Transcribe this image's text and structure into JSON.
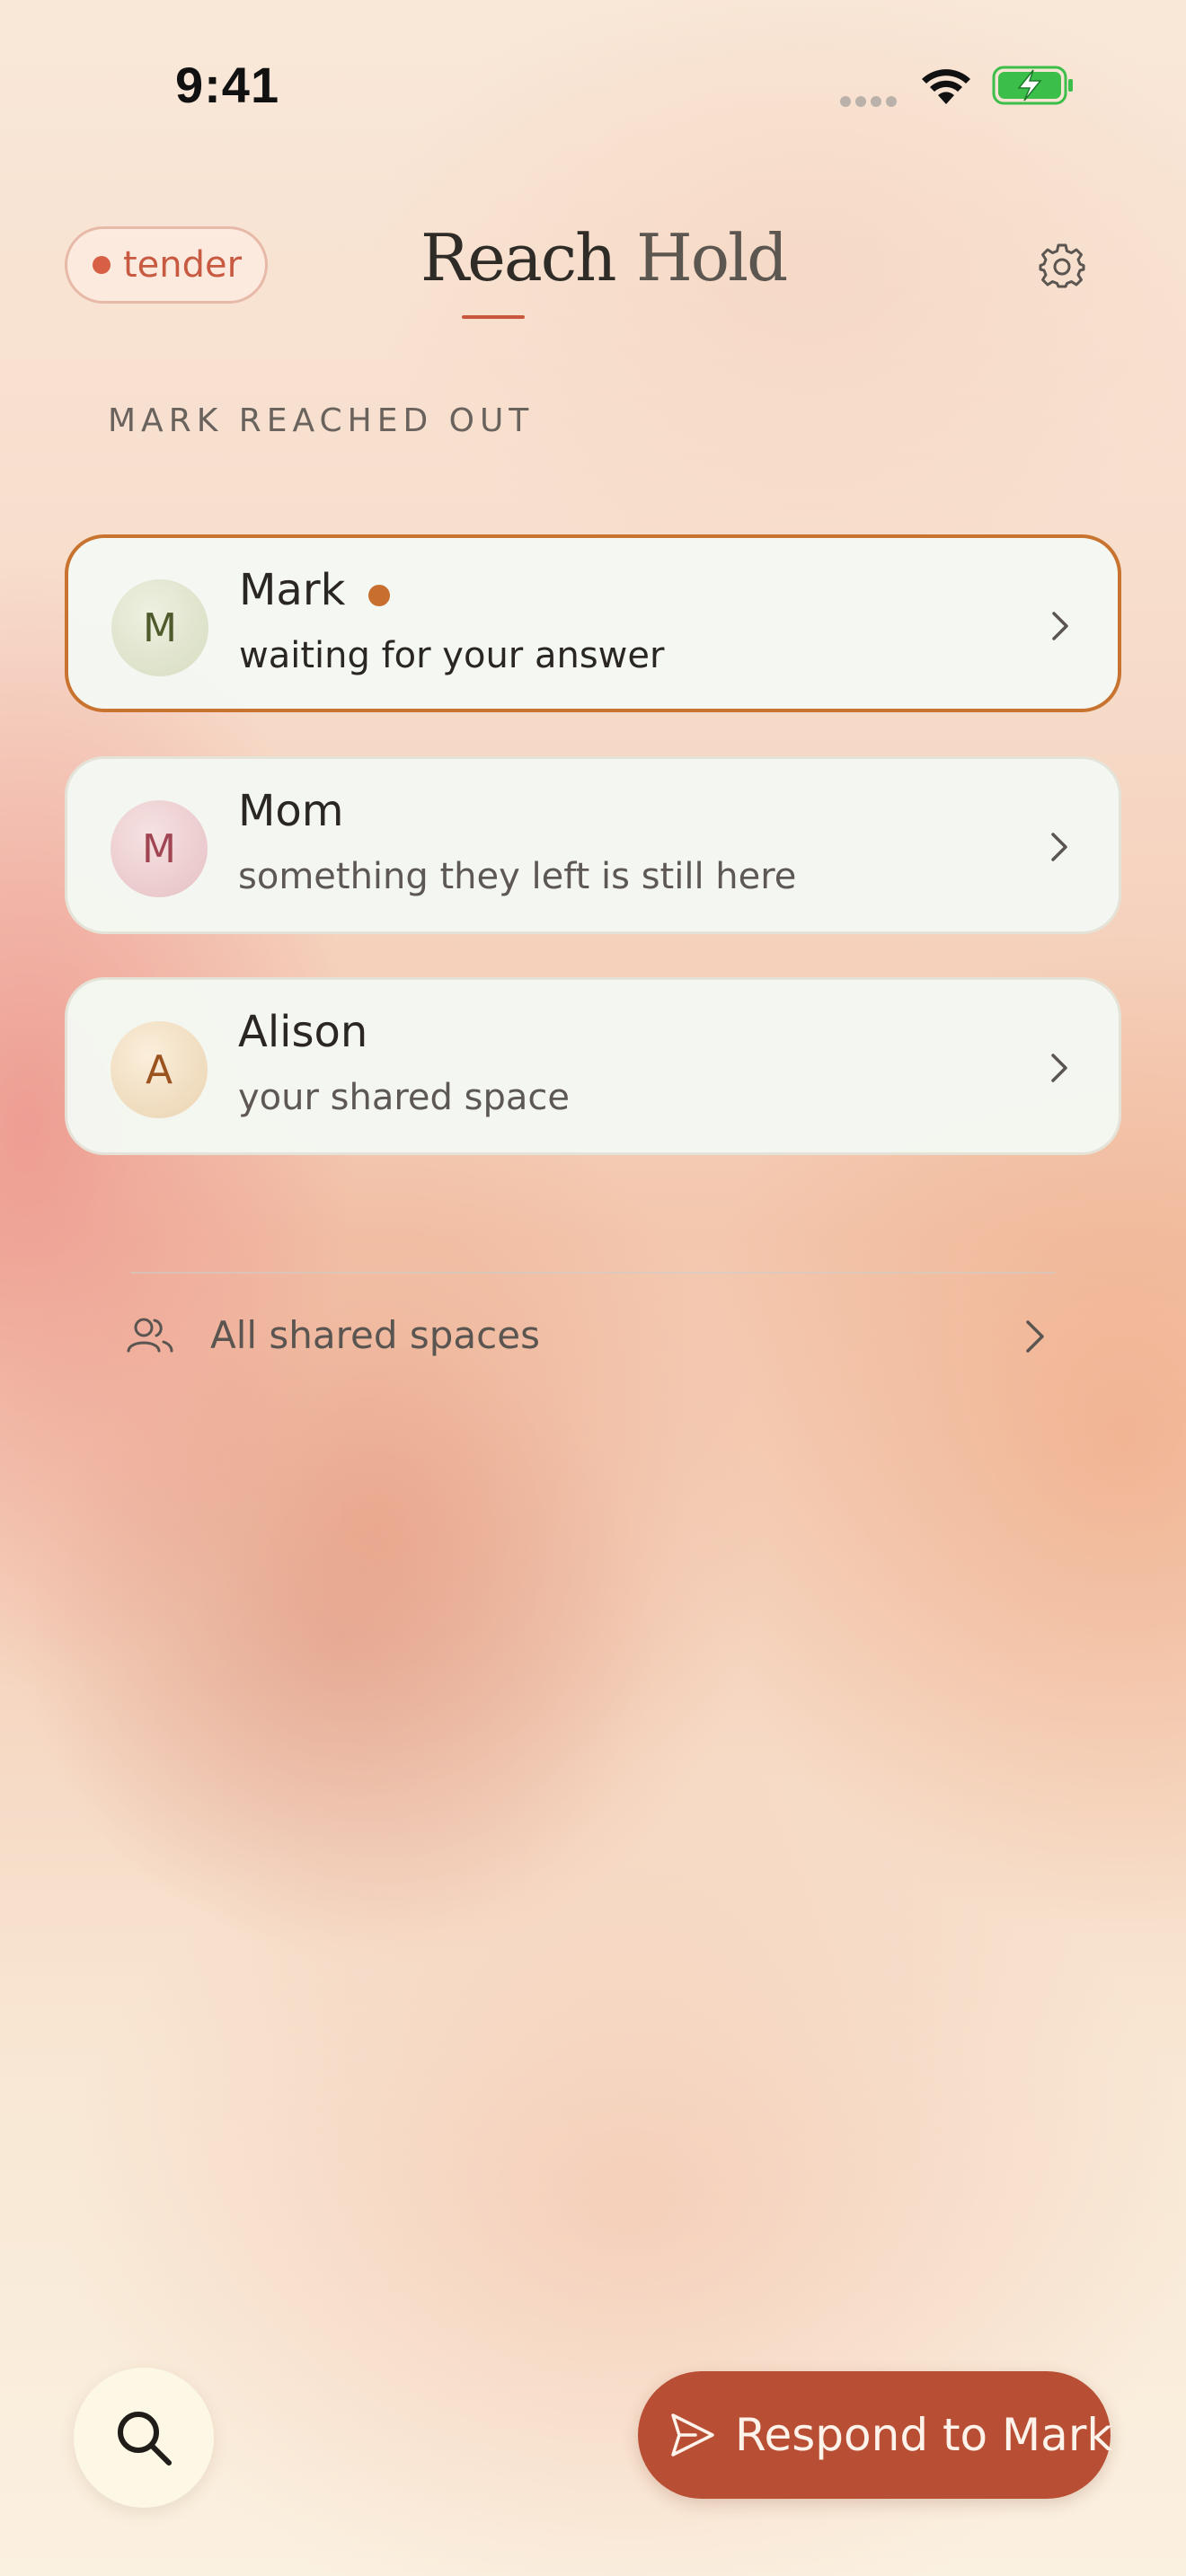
{
  "status_bar": {
    "time": "9:41",
    "battery_color": "#3bbf4a"
  },
  "header": {
    "mood_label": "tender",
    "mood_color": "#d75f46",
    "tabs": [
      {
        "label": "Reach",
        "selected": true
      },
      {
        "label": "Hold",
        "selected": false
      }
    ]
  },
  "section_label": "MARK REACHED OUT",
  "contacts": [
    {
      "initial": "M",
      "name": "Mark",
      "subtitle": "waiting for your answer",
      "unread": true,
      "highlighted": true
    },
    {
      "initial": "M",
      "name": "Mom",
      "subtitle": "something they left is still here",
      "unread": false,
      "highlighted": false
    },
    {
      "initial": "A",
      "name": "Alison",
      "subtitle": "your shared space",
      "unread": false,
      "highlighted": false
    }
  ],
  "shared_spaces_link": "All shared spaces",
  "actions": {
    "respond_label": "Respond to Mark"
  },
  "colors": {
    "accent": "#b84e34",
    "highlight_border": "#c8732f"
  }
}
